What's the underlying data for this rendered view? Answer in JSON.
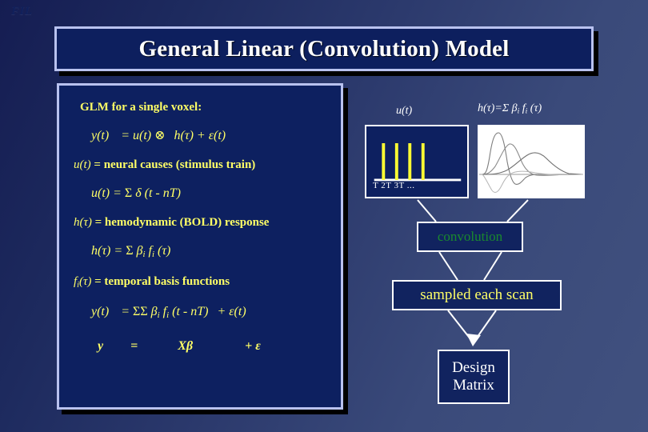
{
  "logo": {
    "text": "FIL"
  },
  "title": {
    "text": "General Linear (Convolution) Model"
  },
  "content": {
    "heading": "GLM for a single voxel:",
    "equations": [
      {
        "id": "eq-y-conv",
        "text": "y(t)  = u(t) ⊗  h(τ) + ε(t)"
      },
      {
        "id": "eq-u-def",
        "text": "u(t) = neural causes (stimulus train)"
      },
      {
        "id": "eq-u-delta",
        "text": "u(t) = Σ δ (t - nT)"
      },
      {
        "id": "eq-h-def",
        "text": "h(τ) = hemodynamic (BOLD) response"
      },
      {
        "id": "eq-h-basis",
        "text": "h(τ) = Σ βi fi (τ)"
      },
      {
        "id": "eq-f-def",
        "text": "fi(τ) = temporal basis functions"
      },
      {
        "id": "eq-y-full",
        "text": "y(t)  = ΣΣ βi fi (t - nT)  + ε(t)"
      },
      {
        "id": "eq-matrix",
        "text": "y      =            Xβ             +  ε"
      }
    ]
  },
  "diagram": {
    "stimulus_plot": {
      "label": "u(t)",
      "tick_labels": "T 2T 3T ...",
      "spike_count": 4,
      "spike_color": "#ffff33",
      "baseline_color": "#ffffff"
    },
    "hrf_plot": {
      "label_parts": {
        "lhs": "h(τ)=Σ β",
        "sub1": "i",
        "mid": " f",
        "sub2": "i",
        "rhs": "(τ)"
      },
      "label_plain": "h(τ)=Σ βi fi (τ)",
      "background": "#ffffff",
      "curve_color": "#808080",
      "basis_count": 4
    },
    "flow": [
      {
        "id": "convolution",
        "label": "convolution",
        "color": "#1a8a2e"
      },
      {
        "id": "sampled",
        "label": "sampled each scan",
        "color": "#ffff66"
      },
      {
        "id": "design-matrix",
        "label_line1": "Design",
        "label_line2": "Matrix",
        "color": "#ffffff"
      }
    ]
  },
  "colors": {
    "background_dark": "#151d52",
    "background_light": "#41517f",
    "box_fill": "#0d2060",
    "box_border": "#b9c2ef",
    "text_yellow": "#ffff66",
    "text_white": "#ffffff",
    "text_green": "#1a8a2e"
  }
}
